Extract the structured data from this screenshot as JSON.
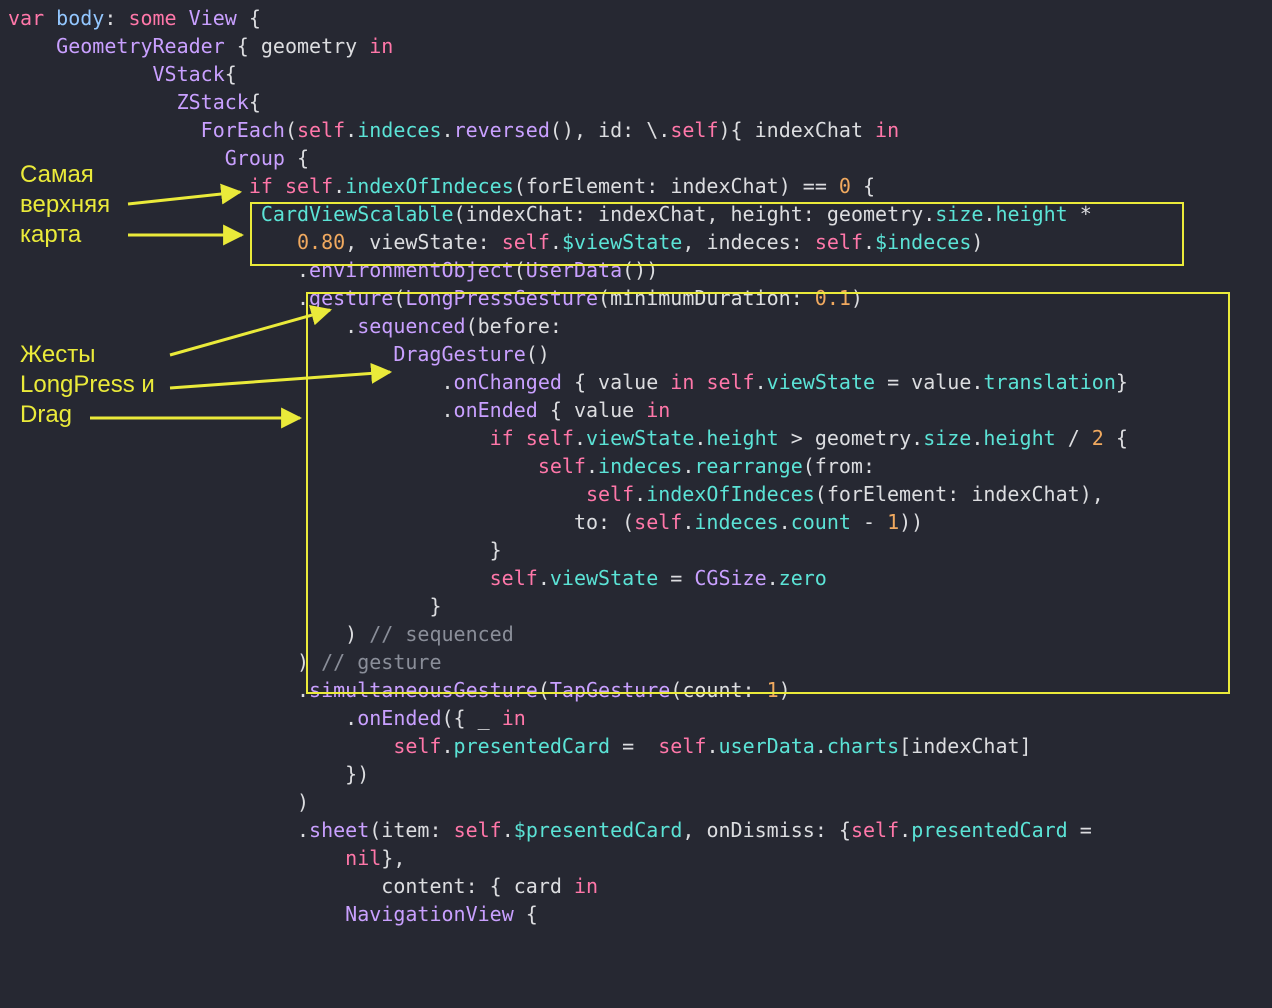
{
  "annotations": {
    "note1_line1": "Самая",
    "note1_line2": "верхняя",
    "note1_line3": "карта",
    "note2_line1": "Жесты",
    "note2_line2": "LongPress и",
    "note2_line3": "Drag"
  },
  "code": {
    "l01_var": "var",
    "l01_body": "body",
    "l01_some": "some",
    "l01_View": "View",
    "l02_GeometryReader": "GeometryReader",
    "l02_geom": "geometry",
    "l02_in": "in",
    "l03_VStack": "VStack",
    "l04_ZStack": "ZStack",
    "l05_ForEach": "ForEach",
    "l05_self": "self",
    "l05_indeces": "indeces",
    "l05_reversed": "reversed",
    "l05_id": "id:",
    "l05_keypath": "\\.",
    "l05_self2": "self",
    "l05_indexChat": "indexChat",
    "l05_in": "in",
    "l06_Group": "Group",
    "l07_if": "if",
    "l07_self": "self",
    "l07_indexOfIndeces": "indexOfIndeces",
    "l07_forElement": "forElement:",
    "l07_indexChat": "indexChat",
    "l07_eq": "==",
    "l07_zero": "0",
    "l08_CardViewScalable": "CardViewScalable",
    "l08_indexChatLbl": "indexChat:",
    "l08_indexChat": "indexChat",
    "l08_heightLbl": "height:",
    "l08_geom": "geometry",
    "l08_size": "size",
    "l08_height": "height",
    "l08_mul": "*",
    "l09_080": "0.80",
    "l09_viewStateLbl": "viewState:",
    "l09_self": "self",
    "l09_viewState": "$viewState",
    "l09_indecesLbl": "indeces:",
    "l09_self2": "self",
    "l09_indeces": "$indeces",
    "l10_environmentObject": "environmentObject",
    "l10_UserData": "UserData",
    "l11_gesture": "gesture",
    "l11_LongPressGesture": "LongPressGesture",
    "l11_minDurLbl": "minimumDuration:",
    "l11_minDur": "0.1",
    "l12_sequenced": "sequenced",
    "l12_before": "before:",
    "l13_DragGesture": "DragGesture",
    "l14_onChanged": "onChanged",
    "l14_value": "value",
    "l14_in": "in",
    "l14_self": "self",
    "l14_viewState": "viewState",
    "l14_eq": "=",
    "l14_value2": "value",
    "l14_translation": "translation",
    "l15_onEnded": "onEnded",
    "l15_value": "value",
    "l15_in": "in",
    "l16_if": "if",
    "l16_self": "self",
    "l16_viewState": "viewState",
    "l16_height": "height",
    "l16_gt": ">",
    "l16_geom": "geometry",
    "l16_size": "size",
    "l16_height2": "height",
    "l16_div": "/",
    "l16_two": "2",
    "l17_self": "self",
    "l17_indeces": "indeces",
    "l17_rearrange": "rearrange",
    "l17_from": "from:",
    "l18_self": "self",
    "l18_indexOfIndeces": "indexOfIndeces",
    "l18_forElement": "forElement:",
    "l18_indexChat": "indexChat",
    "l19_to": "to:",
    "l19_self": "self",
    "l19_indeces": "indeces",
    "l19_count": "count",
    "l19_minus": "-",
    "l19_one": "1",
    "l20_brace": "}",
    "l21_self": "self",
    "l21_viewState": "viewState",
    "l21_eq": "=",
    "l21_CGSize": "CGSize",
    "l21_zero": "zero",
    "l22_brace": "}",
    "l23_paren": ")",
    "l23_cmt": "// sequenced",
    "l24_paren": ")",
    "l24_cmt": "// gesture",
    "l25_simultaneousGesture": "simultaneousGesture",
    "l25_TapGesture": "TapGesture",
    "l25_countLbl": "count:",
    "l25_one": "1",
    "l26_onEnded": "onEnded",
    "l26_underscore": "_",
    "l26_in": "in",
    "l27_self": "self",
    "l27_presentedCard": "presentedCard",
    "l27_eq": "=",
    "l27_self2": "self",
    "l27_userData": "userData",
    "l27_charts": "charts",
    "l27_indexChat": "indexChat",
    "l28_close": "})",
    "l29_paren": ")",
    "l30_sheet": "sheet",
    "l30_itemLbl": "item:",
    "l30_self": "self",
    "l30_presentedCard": "$presentedCard",
    "l30_onDismissLbl": "onDismiss:",
    "l30_self2": "self",
    "l30_presentedCard2": "presentedCard",
    "l30_eq": "=",
    "l31_nil": "nil",
    "l32_contentLbl": "content:",
    "l32_card": "card",
    "l32_in": "in",
    "l33_NavigationView": "NavigationView"
  }
}
